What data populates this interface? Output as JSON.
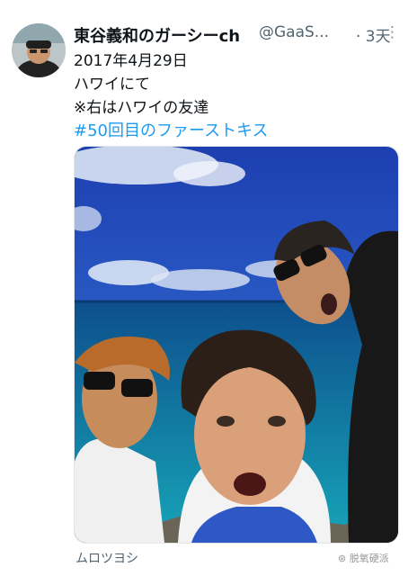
{
  "tweet": {
    "display_name": "東谷義和のガーシーch",
    "handle": "@GaaS...",
    "time_sep": "· 3天",
    "more_icon": "more-icon",
    "text_date": "2017年4月29日",
    "text_line2": "ハワイにて",
    "text_line3": "※右はハワイの友達",
    "hashtag": "#50回目のファーストキス",
    "photo_caption": "ムロツヨシ"
  },
  "watermark": "⊛ 脱氧硬派",
  "colors": {
    "link": "#1d9bf0",
    "muted": "#536471",
    "text": "#0f1419"
  }
}
